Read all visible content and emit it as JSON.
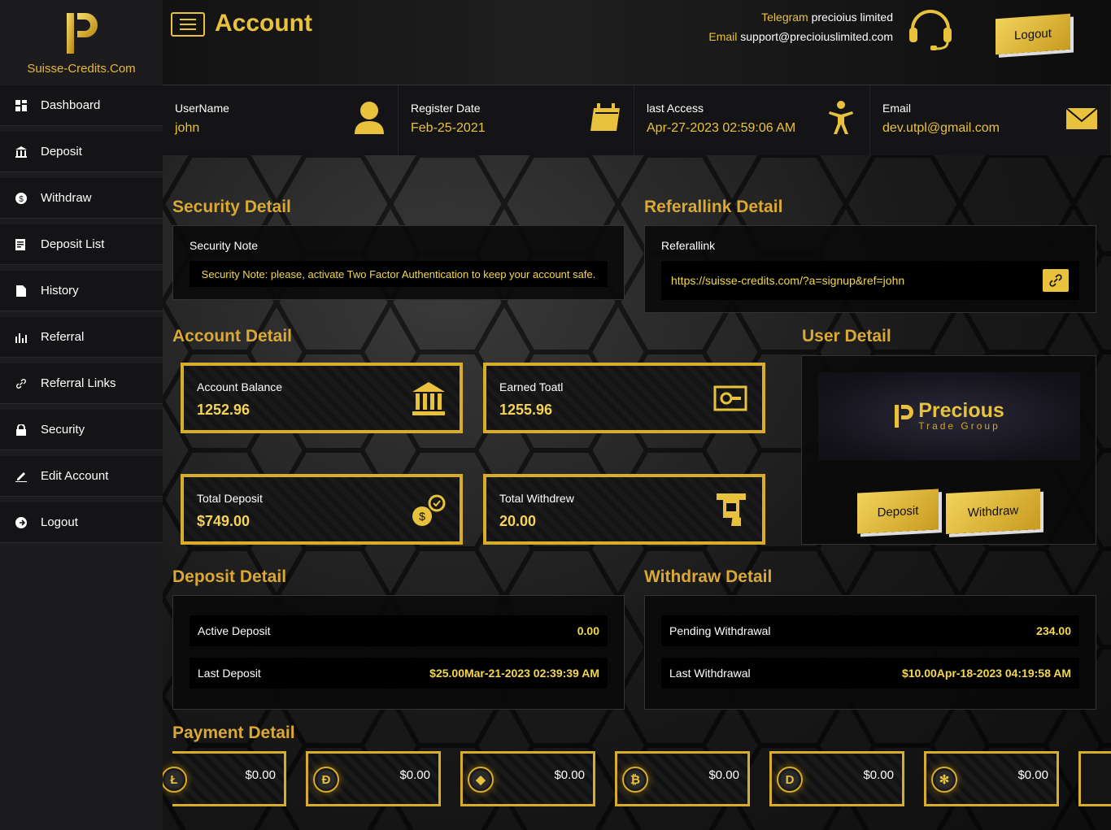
{
  "brand": {
    "name": "Suisse-Credits.Com"
  },
  "sidebar": {
    "items": [
      {
        "label": "Dashboard",
        "icon": "dashboard-icon"
      },
      {
        "label": "Deposit",
        "icon": "bank-icon"
      },
      {
        "label": "Withdraw",
        "icon": "dollar-circle-icon"
      },
      {
        "label": "Deposit List",
        "icon": "list-icon"
      },
      {
        "label": "History",
        "icon": "file-icon"
      },
      {
        "label": "Referral",
        "icon": "chart-icon"
      },
      {
        "label": "Referral Links",
        "icon": "link-icon"
      },
      {
        "label": "Security",
        "icon": "lock-icon"
      },
      {
        "label": "Edit Account",
        "icon": "pencil-icon"
      },
      {
        "label": "Logout",
        "icon": "logout-icon"
      }
    ]
  },
  "header": {
    "title": "Account",
    "telegram_label": "Telegram",
    "telegram_value": "precioius limited",
    "email_label": "Email",
    "email_value": "support@precioiuslimited.com",
    "logout_label": "Logout"
  },
  "info": {
    "username_label": "UserName",
    "username": "john",
    "register_label": "Register Date",
    "register": "Feb-25-2021",
    "access_label": "last Access",
    "access": "Apr-27-2023 02:59:06 AM",
    "email_label": "Email",
    "email": "dev.utpl@gmail.com"
  },
  "security": {
    "title": "Security Detail",
    "label": "Security Note",
    "note": "Security Note: please, activate Two Factor Authentication to keep your account safe."
  },
  "referral": {
    "title": "Referallink Detail",
    "label": "Referallink",
    "link": "https://suisse-credits.com/?a=signup&ref=john"
  },
  "account": {
    "title": "Account Detail",
    "balance_label": "Account Balance",
    "balance": "1252.96",
    "earned_label": "Earned Toatl",
    "earned": "1255.96",
    "deposit_label": "Total Deposit",
    "deposit": "$749.00",
    "withdrew_label": "Total Withdrew",
    "withdrew": "20.00"
  },
  "user": {
    "title": "User Detail",
    "logo_name": "Precious",
    "logo_sub": "Trade Group",
    "deposit_btn": "Deposit",
    "withdraw_btn": "Withdraw"
  },
  "deposit_detail": {
    "title": "Deposit Detail",
    "active_label": "Active Deposit",
    "active": "0.00",
    "last_label": "Last Deposit",
    "last": "$25.00Mar-21-2023 02:39:39 AM"
  },
  "withdraw_detail": {
    "title": "Withdraw Detail",
    "pending_label": "Pending Withdrawal",
    "pending": "234.00",
    "last_label": "Last Withdrawal",
    "last": "$10.00Apr-18-2023 04:19:58 AM"
  },
  "payment": {
    "title": "Payment Detail",
    "cards": [
      {
        "coin": "Ł",
        "amount": "$0.00",
        "icon": "litecoin-icon"
      },
      {
        "coin": "Ð",
        "amount": "$0.00",
        "icon": "dogecoin-icon"
      },
      {
        "coin": "◆",
        "amount": "$0.00",
        "icon": "ethereum-icon"
      },
      {
        "coin": "₿",
        "amount": "$0.00",
        "icon": "bitcoin-icon"
      },
      {
        "coin": "D",
        "amount": "$0.00",
        "icon": "dash-icon"
      },
      {
        "coin": "✻",
        "amount": "$0.00",
        "icon": "ripple-icon"
      }
    ]
  },
  "colors": {
    "gold": "#e8c23c",
    "dark": "#141416"
  }
}
